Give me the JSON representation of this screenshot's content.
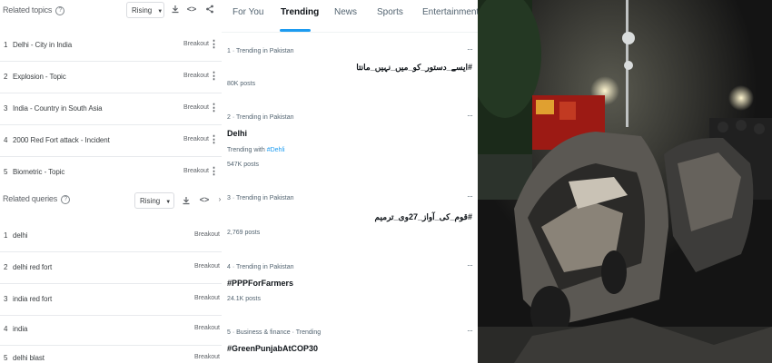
{
  "trends": {
    "related_topics": {
      "title": "Related topics",
      "filter": "Rising",
      "icons": [
        "download-icon",
        "embed-icon",
        "share-icon"
      ],
      "items": [
        {
          "rank": "1",
          "name": "Delhi - City in India",
          "value": "Breakout"
        },
        {
          "rank": "2",
          "name": "Explosion - Topic",
          "value": "Breakout"
        },
        {
          "rank": "3",
          "name": "India - Country in South Asia",
          "value": "Breakout"
        },
        {
          "rank": "4",
          "name": "2000 Red Fort attack - Incident",
          "value": "Breakout"
        },
        {
          "rank": "5",
          "name": "Biometric - Topic",
          "value": "Breakout"
        }
      ]
    },
    "related_queries": {
      "title": "Related queries",
      "filter": "Rising",
      "icons": [
        "download-icon",
        "embed-icon"
      ],
      "items": [
        {
          "rank": "1",
          "name": "delhi",
          "value": "Breakout"
        },
        {
          "rank": "2",
          "name": "delhi red fort",
          "value": "Breakout"
        },
        {
          "rank": "3",
          "name": "india red fort",
          "value": "Breakout"
        },
        {
          "rank": "4",
          "name": "india",
          "value": "Breakout"
        },
        {
          "rank": "5",
          "name": "delhi blast",
          "value": "Breakout"
        }
      ]
    }
  },
  "x_trending": {
    "tabs": [
      "For You",
      "Trending",
      "News",
      "Sports",
      "Entertainment"
    ],
    "active_tab": "Trending",
    "accent": "#1d9bf0",
    "trends": [
      {
        "context": "1 · Trending in Pakistan",
        "name": "#ایسے_دستور_کو_میں_نہیں_مانتا",
        "with": "",
        "with_tag": "",
        "posts": "80K posts"
      },
      {
        "context": "2 · Trending in Pakistan",
        "name": "Delhi",
        "with": "Trending with",
        "with_tag": "#Dehli",
        "posts": "547K posts"
      },
      {
        "context": "3 · Trending in Pakistan",
        "name": "#قوم_کی_آواز_27وی_ترمیم",
        "with": "",
        "with_tag": "",
        "posts": "2,769 posts"
      },
      {
        "context": "4 · Trending in Pakistan",
        "name": "#PPPForFarmers",
        "with": "",
        "with_tag": "",
        "posts": "24.1K posts"
      },
      {
        "context": "5 · Business & finance · Trending",
        "name": "#GreenPunjabAtCOP30",
        "with": "",
        "with_tag": "",
        "posts": ""
      }
    ],
    "more_label": "···"
  },
  "photo": {
    "subject": "burnt-out-cars-night-scene"
  }
}
